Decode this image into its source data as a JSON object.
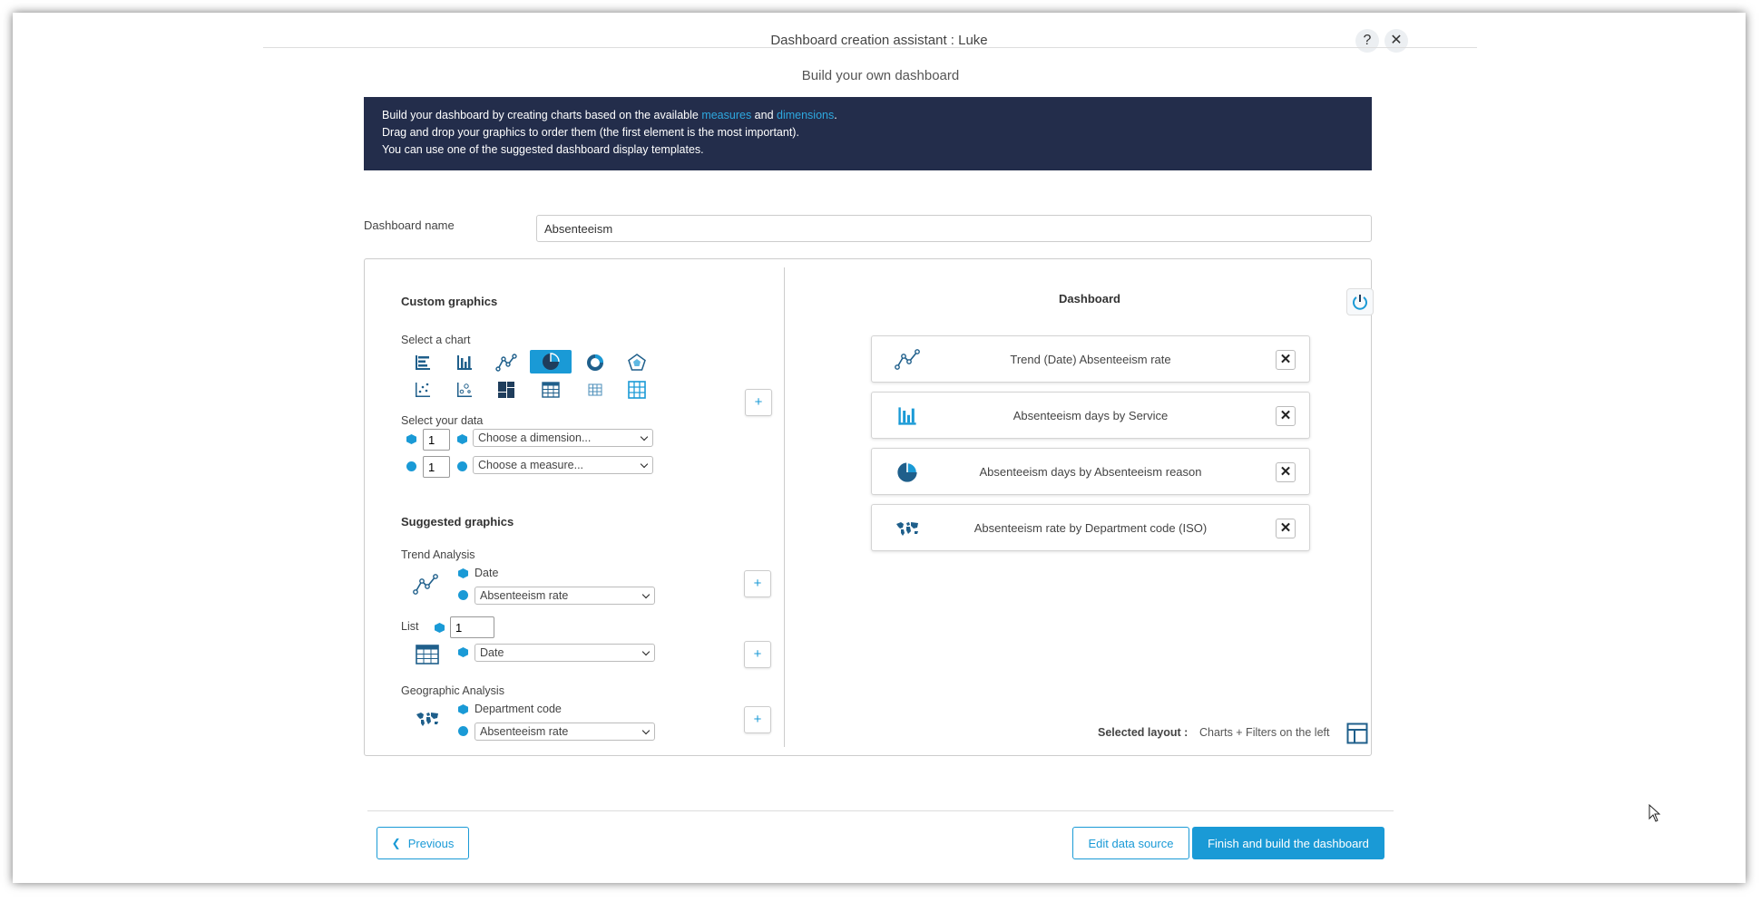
{
  "window": {
    "title": "Dashboard creation assistant : Luke",
    "help_label": "?",
    "close_label": "✕"
  },
  "subtitle": "Build your own dashboard",
  "banner": {
    "line1_pre": "Build your dashboard by creating charts based on the available ",
    "link_measures": "measures",
    "and": " and ",
    "link_dimensions": "dimensions",
    "line1_post": ".",
    "line2": "Drag and drop your graphics to order them (the first element is the most important).",
    "line3": "You can use one of the suggested dashboard display templates."
  },
  "dashboard_name": {
    "label": "Dashboard name",
    "value": "Absenteeism"
  },
  "custom": {
    "title": "Custom graphics",
    "select_chart_label": "Select a chart",
    "chart_types": [
      "horizontal-bar",
      "vertical-bar",
      "line",
      "pie",
      "donut",
      "radar",
      "scatter",
      "bubble",
      "treemap",
      "table",
      "pivot-table",
      "grid-table"
    ],
    "selected_chart": "pie",
    "select_data_label": "Select your data",
    "dimension_count": "1",
    "dimension_placeholder": "Choose a dimension...",
    "measure_count": "1",
    "measure_placeholder": "Choose a measure...",
    "add_label": "+"
  },
  "suggested": {
    "title": "Suggested graphics",
    "trend": {
      "label": "Trend Analysis",
      "dimension": "Date",
      "measure": "Absenteeism rate"
    },
    "list": {
      "label": "List",
      "count": "1",
      "dimension": "Date"
    },
    "geo": {
      "label": "Geographic Analysis",
      "dimension": "Department code",
      "measure": "Absenteeism rate"
    },
    "add_label": "+"
  },
  "dashboard": {
    "title": "Dashboard",
    "items": [
      {
        "icon": "line-chart-icon",
        "label": "Trend (Date) Absenteeism rate"
      },
      {
        "icon": "bar-chart-icon",
        "label": "Absenteeism days by Service"
      },
      {
        "icon": "pie-chart-icon",
        "label": "Absenteeism days by Absenteeism reason"
      },
      {
        "icon": "world-map-icon",
        "label": "Absenteeism rate by Department code (ISO)"
      }
    ],
    "remove_label": "✕",
    "selected_layout_label": "Selected layout :",
    "selected_layout_value": "Charts + Filters on the left"
  },
  "footer": {
    "previous": "Previous",
    "edit_source": "Edit data source",
    "finish": "Finish and build the dashboard"
  },
  "colors": {
    "accent": "#1a9ad6",
    "banner_bg": "#232d4b",
    "icon_blue": "#1f5f8b"
  }
}
